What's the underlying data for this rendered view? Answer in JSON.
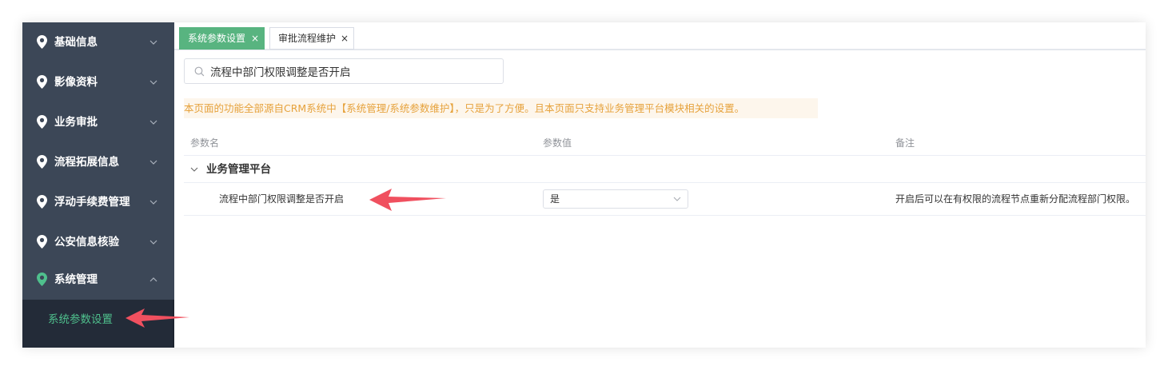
{
  "sidebar": {
    "items": [
      {
        "label": "基础信息",
        "icon": "map-pin-icon",
        "expanded": false
      },
      {
        "label": "影像资料",
        "icon": "map-pin-icon",
        "expanded": false
      },
      {
        "label": "业务审批",
        "icon": "map-pin-icon",
        "expanded": false
      },
      {
        "label": "流程拓展信息",
        "icon": "map-pin-icon",
        "expanded": false
      },
      {
        "label": "浮动手续费管理",
        "icon": "map-pin-icon",
        "expanded": false
      },
      {
        "label": "公安信息核验",
        "icon": "map-pin-icon",
        "expanded": false
      },
      {
        "label": "系统管理",
        "icon": "map-pin-icon",
        "expanded": true
      }
    ],
    "submenu": {
      "label": "系统参数设置"
    }
  },
  "tabs": [
    {
      "label": "系统参数设置",
      "close": "×",
      "active": true
    },
    {
      "label": "审批流程维护",
      "close": "×",
      "active": false
    }
  ],
  "search": {
    "value": "流程中部门权限调整是否开启",
    "icon": "search-icon"
  },
  "notice": "本页面的功能全部源自CRM系统中【系统管理/系统参数维护】，只是为了方便。且本页面只支持业务管理平台模块相关的设置。",
  "table": {
    "headers": [
      "参数名",
      "参数值",
      "备注"
    ],
    "group": {
      "title": "业务管理平台"
    },
    "rows": [
      {
        "name": "流程中部门权限调整是否开启",
        "value": "是",
        "remark": "开启后可以在有权限的流程节点重新分配流程部门权限。"
      }
    ]
  },
  "colors": {
    "sidebar_bg": "#3c4757",
    "active_tab": "#58b480",
    "active_icon": "#4fc08d",
    "notice_text": "#e6a23c",
    "arrow": "#f0505f"
  }
}
